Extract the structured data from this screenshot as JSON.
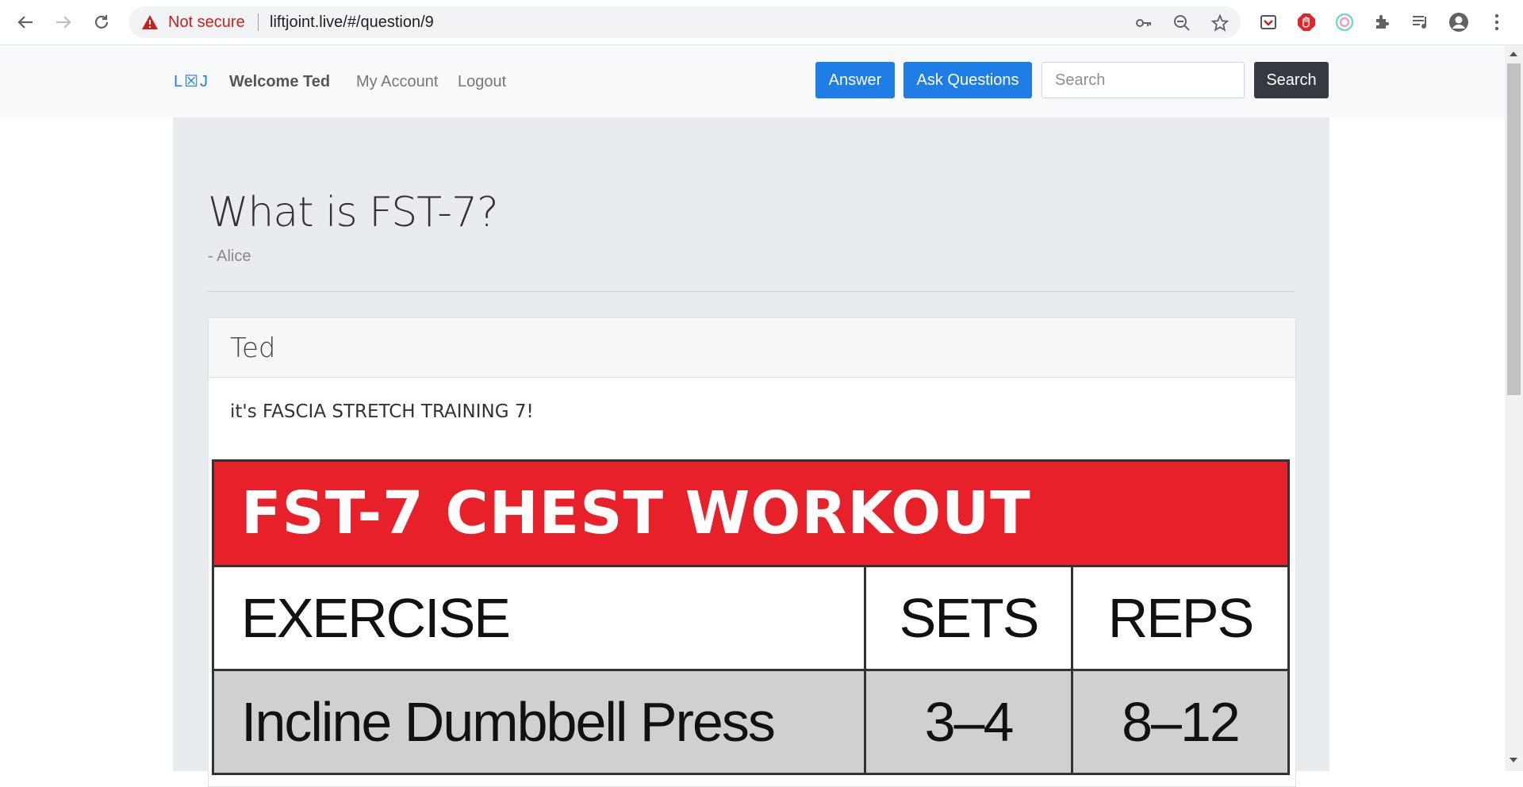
{
  "browser": {
    "security_label": "Not secure",
    "url": "liftjoint.live/#/question/9",
    "icons": [
      "back-icon",
      "forward-icon",
      "reload-icon",
      "warning-icon",
      "key-icon",
      "zoom-out-icon",
      "star-icon",
      "pocket-icon",
      "adblock-icon",
      "extension-icon",
      "puzzle-icon",
      "media-queue-icon",
      "profile-icon",
      "menu-icon"
    ]
  },
  "navbar": {
    "brand": "L☒J",
    "welcome": "Welcome Ted",
    "my_account": "My Account",
    "logout": "Logout",
    "answer_button": "Answer",
    "ask_button": "Ask Questions",
    "search_placeholder": "Search",
    "search_button": "Search"
  },
  "question": {
    "title": "What is FST-7?",
    "author": "- Alice"
  },
  "answer": {
    "author": "Ted",
    "text": "it's FASCIA STRETCH TRAINING 7!"
  },
  "workout_image": {
    "title": "FST-7 CHEST WORKOUT",
    "headers": [
      "EXERCISE",
      "SETS",
      "REPS"
    ],
    "rows": [
      [
        "Incline Dumbbell Press",
        "3–4",
        "8–12"
      ]
    ]
  },
  "colors": {
    "primary": "#1e7ee6",
    "dark": "#343a40",
    "jumbotron": "#e9ecef",
    "not_secure": "#c5221f",
    "workout_red": "#e8202a"
  }
}
